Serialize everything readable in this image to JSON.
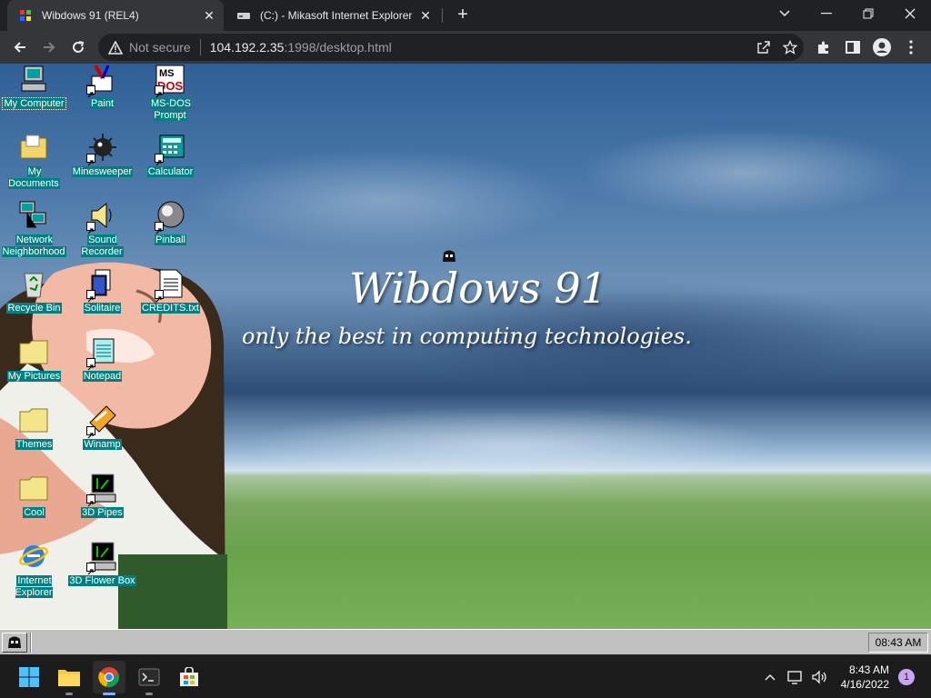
{
  "browser": {
    "tabs": [
      {
        "title": "Wibdows 91 (REL4)",
        "active": true
      },
      {
        "title": "(C:) - Mikasoft Internet Explorer",
        "active": false
      }
    ],
    "omnibox": {
      "security_label": "Not secure",
      "host": "104.192.2.35",
      "rest": ":1998/desktop.html"
    }
  },
  "desktop": {
    "title": "Wibdows 91",
    "subtitle": "only the best in computing technologies.",
    "label_bg_color": "#008080",
    "icons": [
      {
        "label": "My Computer",
        "icon": "my-computer-icon"
      },
      {
        "label": "Paint",
        "icon": "paint-icon"
      },
      {
        "label": "MS-DOS Prompt",
        "icon": "ms-dos-icon"
      },
      {
        "label": "My Documents",
        "icon": "folder-documents-icon"
      },
      {
        "label": "Minesweeper",
        "icon": "minesweeper-icon"
      },
      {
        "label": "Calculator",
        "icon": "calculator-icon"
      },
      {
        "label": "Network Neighborhood",
        "icon": "network-icon"
      },
      {
        "label": "Sound Recorder",
        "icon": "speaker-icon"
      },
      {
        "label": "Pinball",
        "icon": "pinball-icon"
      },
      {
        "label": "Recycle Bin",
        "icon": "recycle-bin-icon"
      },
      {
        "label": "Solitaire",
        "icon": "solitaire-icon"
      },
      {
        "label": "CREDITS.txt",
        "icon": "text-file-icon"
      },
      {
        "label": "My Pictures",
        "icon": "folder-icon"
      },
      {
        "label": "Notepad",
        "icon": "notepad-icon"
      },
      {
        "label": "Themes",
        "icon": "folder-icon"
      },
      {
        "label": "Winamp",
        "icon": "winamp-icon"
      },
      {
        "label": "Cool",
        "icon": "folder-icon"
      },
      {
        "label": "3D Pipes",
        "icon": "screensaver-icon"
      },
      {
        "label": "Internet Explorer",
        "icon": "internet-explorer-icon"
      },
      {
        "label": "3D Flower Box",
        "icon": "screensaver-icon"
      }
    ],
    "taskbar": {
      "clock": "08:43 AM"
    }
  },
  "os_taskbar": {
    "time": "8:43 AM",
    "date": "4/16/2022",
    "notifications": "1"
  }
}
